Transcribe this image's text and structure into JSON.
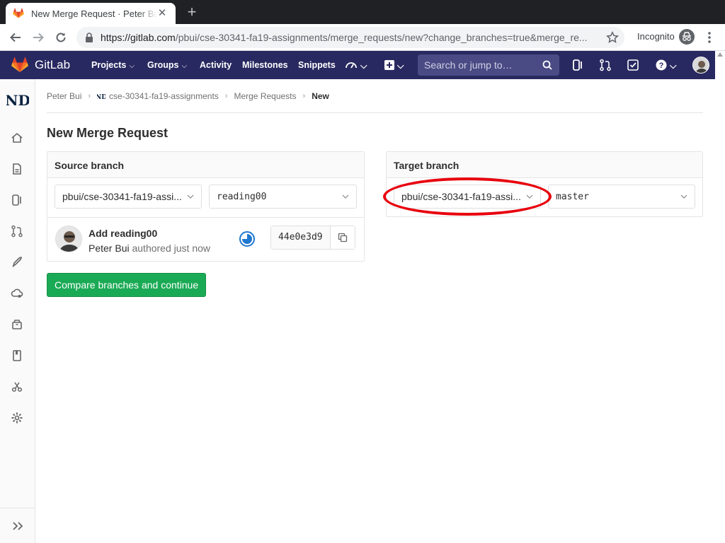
{
  "browser": {
    "tab_title": "New Merge Request · Peter Bui",
    "url_host": "https://gitlab.com",
    "url_path": "/pbui/cse-30341-fa19-assignments/merge_requests/new?change_branches=true&merge_re...",
    "incognito_label": "Incognito"
  },
  "gitlab_nav": {
    "brand": "GitLab",
    "projects": "Projects",
    "groups": "Groups",
    "activity": "Activity",
    "milestones": "Milestones",
    "snippets": "Snippets",
    "search_placeholder": "Search or jump to…",
    "colors": {
      "nav_bg": "#292961",
      "search_bg": "#4a4a85"
    }
  },
  "breadcrumb": {
    "owner": "Peter Bui",
    "project": "cse-30341-fa19-assignments",
    "section": "Merge Requests",
    "current": "New"
  },
  "page": {
    "title": "New Merge Request",
    "compare_button": "Compare branches and continue"
  },
  "source": {
    "heading": "Source branch",
    "project": "pbui/cse-30341-fa19-assi...",
    "branch": "reading00",
    "commit": {
      "title": "Add reading00",
      "author": "Peter Bui",
      "authored": "authored just now",
      "sha": "44e0e3d9"
    }
  },
  "target": {
    "heading": "Target branch",
    "project": "pbui/cse-30341-fa19-assi...",
    "branch": "master"
  },
  "colors": {
    "success": "#1aaa55",
    "annotation": "#e8000d"
  }
}
